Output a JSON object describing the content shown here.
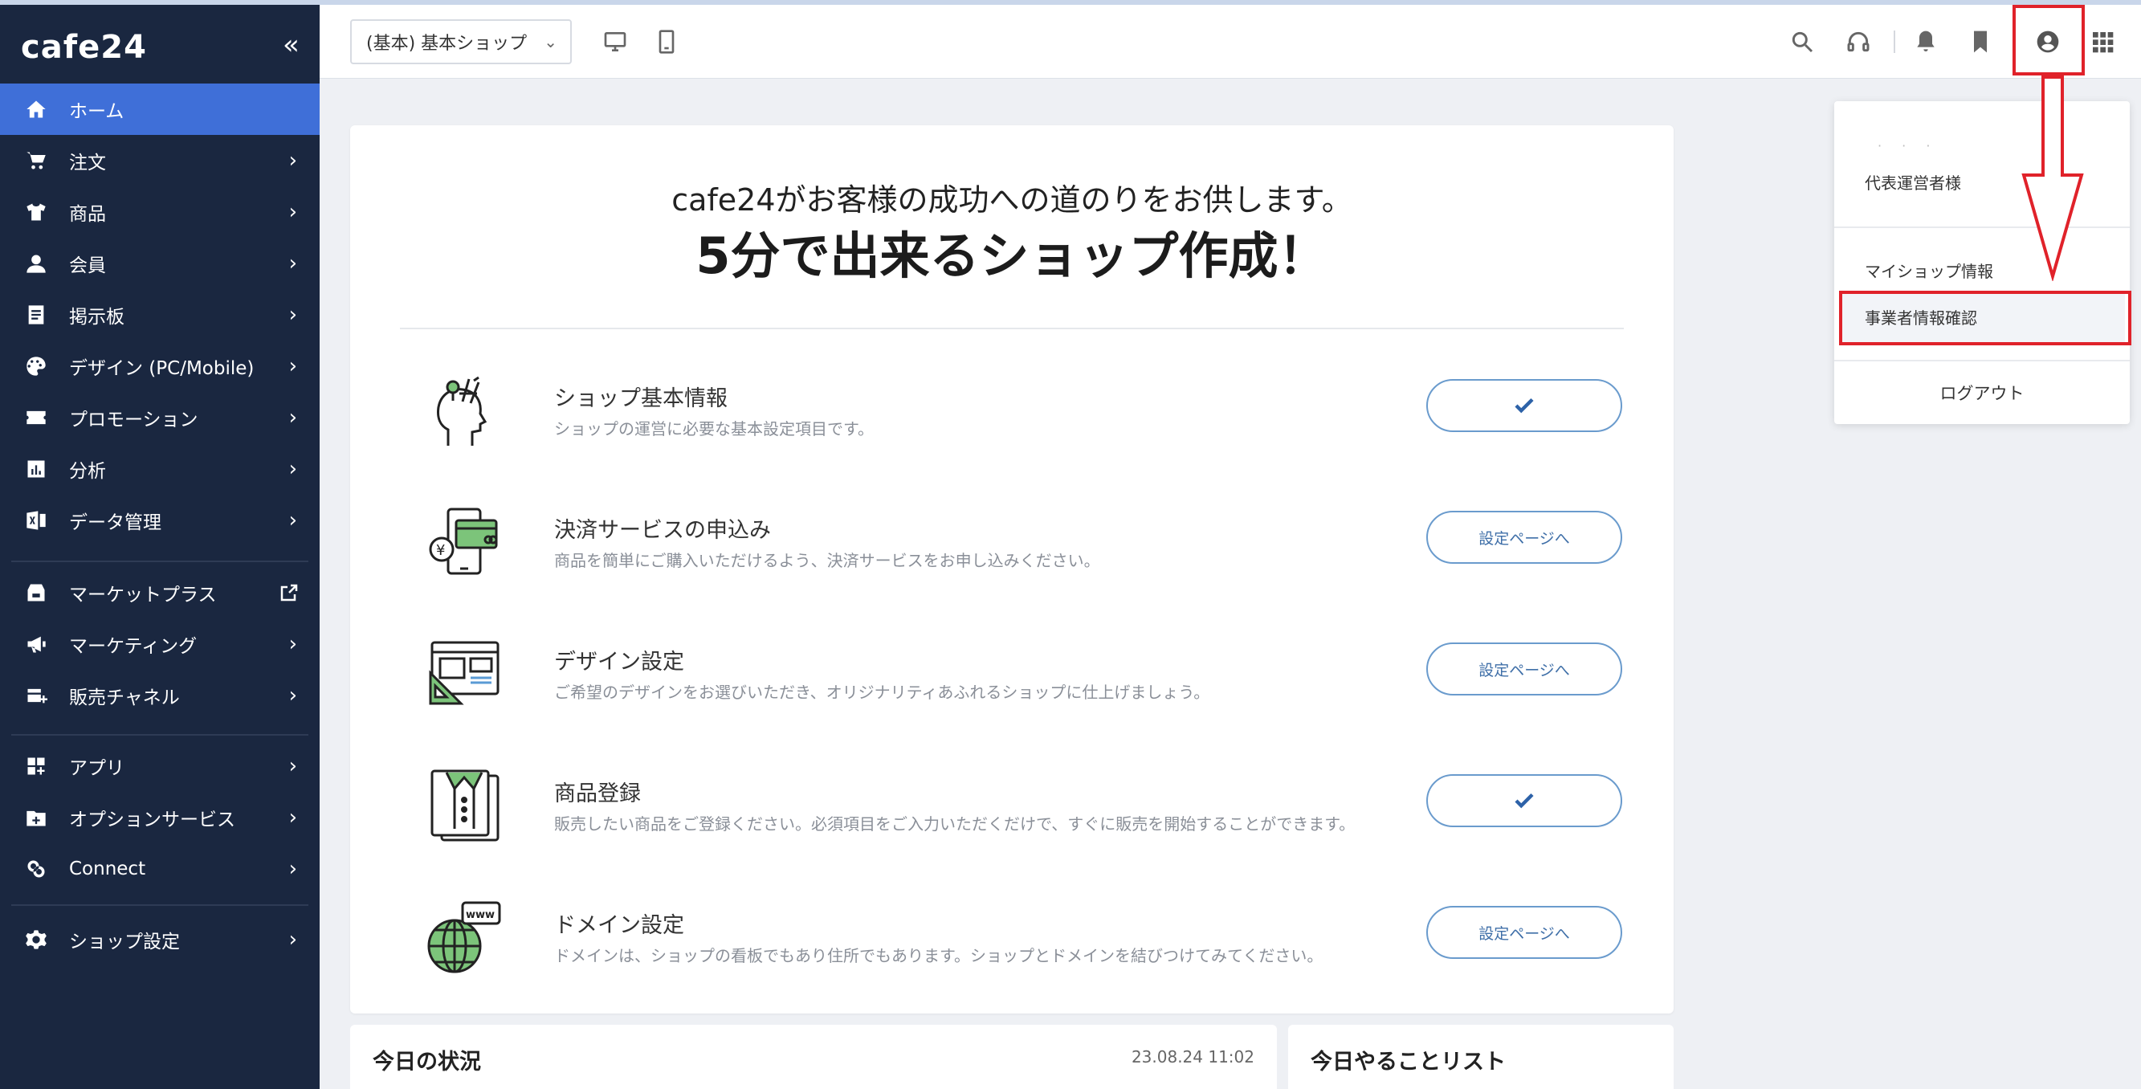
{
  "sidebar": {
    "logo": "cafe24",
    "collapse": "«",
    "items": [
      {
        "label": "ホーム",
        "icon": "home-icon",
        "active": true
      },
      {
        "label": "注文",
        "icon": "cart-icon"
      },
      {
        "label": "商品",
        "icon": "shirt-icon"
      },
      {
        "label": "会員",
        "icon": "user-icon"
      },
      {
        "label": "掲示板",
        "icon": "board-icon"
      },
      {
        "label": "デザイン (PC/Mobile)",
        "icon": "palette-icon"
      },
      {
        "label": "プロモーション",
        "icon": "coupon-icon"
      },
      {
        "label": "分析",
        "icon": "chart-icon"
      },
      {
        "label": "データ管理",
        "icon": "excel-icon"
      },
      {
        "label": "マーケットプラス",
        "icon": "store-icon"
      },
      {
        "label": "マーケティング",
        "icon": "megaphone-icon"
      },
      {
        "label": "販売チャネル",
        "icon": "channel-icon"
      },
      {
        "label": "アプリ",
        "icon": "apps-icon"
      },
      {
        "label": "オプションサービス",
        "icon": "folder-plus-icon"
      },
      {
        "label": "Connect",
        "icon": "connect-icon"
      },
      {
        "label": "ショップ設定",
        "icon": "gear-icon"
      }
    ]
  },
  "header": {
    "shop_select": "(基本) 基本ショップ"
  },
  "main": {
    "subtitle": "cafe24がお客様の成功への道のりをお供します。",
    "title": "5分で出来るショップ作成！",
    "tasks": [
      {
        "title": "ショップ基本情報",
        "desc": "ショップの運営に必要な基本設定項目です。",
        "button": "",
        "done": true,
        "icon": "head-tools-icon"
      },
      {
        "title": "決済サービスの申込み",
        "desc": "商品を簡単にご購入いただけるよう、決済サービスをお申し込みください。",
        "button": "設定ページへ",
        "done": false,
        "icon": "payment-phone-icon"
      },
      {
        "title": "デザイン設定",
        "desc": "ご希望のデザインをお選びいただき、オリジナリティあふれるショップに仕上げましょう。",
        "button": "設定ページへ",
        "done": false,
        "icon": "design-layout-icon"
      },
      {
        "title": "商品登録",
        "desc": "販売したい商品をご登録ください。必須項目をご入力いただくだけで、すぐに販売を開始することができます。",
        "button": "",
        "done": true,
        "icon": "product-shirt-icon"
      },
      {
        "title": "ドメイン設定",
        "desc": "ドメインは、ショップの看板でもあり住所でもあります。ショップとドメインを結びつけてみてください。",
        "button": "設定ページへ",
        "done": false,
        "icon": "globe-www-icon"
      }
    ]
  },
  "bottom": {
    "today_title": "今日の状況",
    "today_date": "23.08.24 11:02",
    "todo_title": "今日やることリスト"
  },
  "dropdown": {
    "role": "代表運営者様",
    "my_shop": "マイショップ情報",
    "business_info": "事業者情報確認",
    "logout": "ログアウト"
  }
}
